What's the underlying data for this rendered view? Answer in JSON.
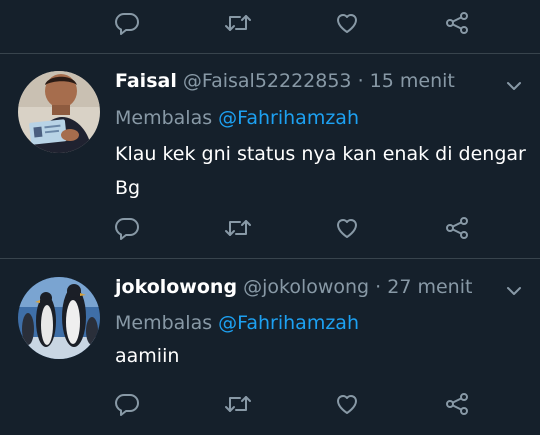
{
  "colors": {
    "background": "#15202b",
    "divider": "#38444d",
    "text_primary": "#ffffff",
    "text_secondary": "#8899a6",
    "link": "#1da1f2"
  },
  "action_icons": [
    "reply-icon",
    "retweet-icon",
    "like-icon",
    "share-icon"
  ],
  "tweets": [
    {
      "name": "Faisal",
      "handle": "@Faisal52222853",
      "time": "· 15 menit",
      "reply_prefix": "Membalas",
      "reply_to": "@Fahrihamzah",
      "text": "Klau kek gni status nya kan enak di dengar Bg"
    },
    {
      "name": "jokolowong",
      "handle": "@jokolowong",
      "time": "· 27 menit",
      "reply_prefix": "Membalas",
      "reply_to": "@Fahrihamzah",
      "text": "aamiin"
    }
  ]
}
